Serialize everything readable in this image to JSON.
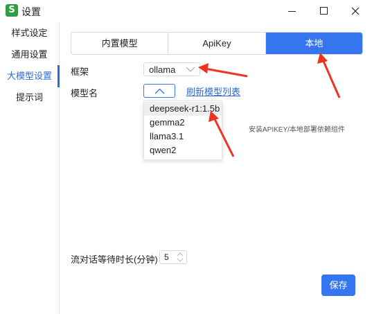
{
  "window": {
    "title": "设置",
    "app_icon_letter": "S"
  },
  "sidebar": {
    "items": [
      {
        "label": "样式设定"
      },
      {
        "label": "通用设置"
      },
      {
        "label": "大模型设置",
        "active": true
      },
      {
        "label": "提示词"
      }
    ]
  },
  "tabs": [
    {
      "label": "内置模型"
    },
    {
      "label": "ApiKey"
    },
    {
      "label": "本地",
      "active": true
    }
  ],
  "form": {
    "framework_label": "框架",
    "framework_value": "ollama",
    "model_label": "模型名",
    "refresh_link": "刷新模型列表",
    "model_options": [
      "deepseek-r1:1.5b",
      "gemma2",
      "llama3.1",
      "qwen2"
    ],
    "hovered_option": "deepseek-r1:1.5b",
    "dependency_hint": "安装APIKEY/本地部署依赖组件",
    "wait_time_label": "流对话等待时长(分钟)",
    "wait_time_value": "5",
    "save_button": "保存"
  },
  "colors": {
    "accent": "#3575f0",
    "link": "#2f6bdc",
    "annotation_arrow": "#ee3322",
    "app_icon": "#2f9e44"
  },
  "icons": [
    "app-icon",
    "minimize-icon",
    "maximize-icon",
    "close-icon",
    "chevron-down-icon",
    "chevron-up-icon",
    "spinner-arrows-icon"
  ]
}
